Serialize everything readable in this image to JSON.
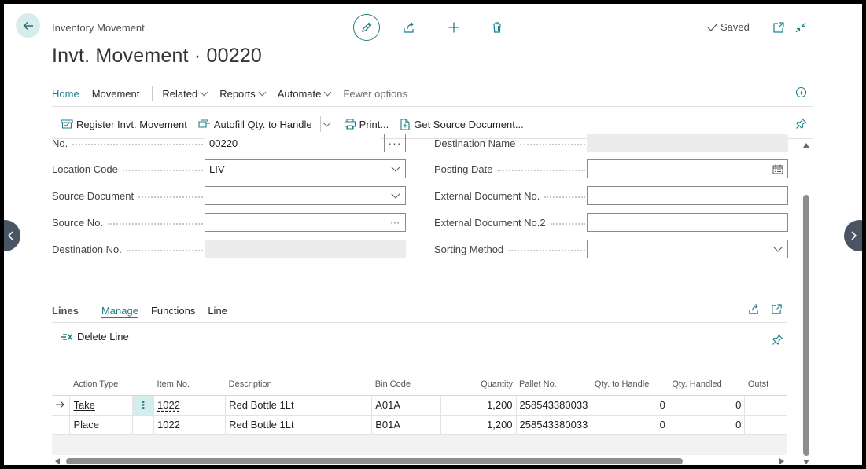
{
  "header": {
    "breadcrumb": "Inventory Movement",
    "title": "Invt. Movement · 00220",
    "saved_label": "Saved"
  },
  "menu": {
    "items": [
      {
        "label": "Home"
      },
      {
        "label": "Movement"
      },
      {
        "label": "Related"
      },
      {
        "label": "Reports"
      },
      {
        "label": "Automate"
      },
      {
        "label": "Fewer options"
      }
    ]
  },
  "toolbar": {
    "register": "Register Invt. Movement",
    "autofill": "Autofill Qty. to Handle",
    "print": "Print...",
    "get_source": "Get Source Document..."
  },
  "form": {
    "left": [
      {
        "label": "No.",
        "value": "00220"
      },
      {
        "label": "Location Code",
        "value": "LIV"
      },
      {
        "label": "Source Document",
        "value": ""
      },
      {
        "label": "Source No.",
        "value": ""
      },
      {
        "label": "Destination No.",
        "value": ""
      }
    ],
    "right": [
      {
        "label": "Destination Name",
        "value": ""
      },
      {
        "label": "Posting Date",
        "value": ""
      },
      {
        "label": "External Document No.",
        "value": ""
      },
      {
        "label": "External Document No.2",
        "value": ""
      },
      {
        "label": "Sorting Method",
        "value": ""
      }
    ]
  },
  "lines": {
    "title": "Lines",
    "tabs": [
      {
        "label": "Manage"
      },
      {
        "label": "Functions"
      },
      {
        "label": "Line"
      }
    ],
    "delete_line": "Delete Line",
    "columns": [
      "Action Type",
      "Item No.",
      "Description",
      "Bin Code",
      "Quantity",
      "Pallet No.",
      "Qty. to Handle",
      "Qty. Handled",
      "Outst"
    ],
    "rows": [
      {
        "action_type": "Take",
        "item_no": "1022",
        "description": "Red Bottle 1Lt",
        "bin_code": "A01A",
        "quantity": "1,200",
        "pallet_no": "258543380033",
        "qty_to_handle": "0",
        "qty_handled": "0"
      },
      {
        "action_type": "Place",
        "item_no": "1022",
        "description": "Red Bottle 1Lt",
        "bin_code": "B01A",
        "quantity": "1,200",
        "pallet_no": "258543380033",
        "qty_to_handle": "0",
        "qty_handled": "0"
      }
    ]
  },
  "colors": {
    "accent": "#1d7f86",
    "selected_cell": "#d3ecec",
    "disabled_field": "#ececec"
  }
}
